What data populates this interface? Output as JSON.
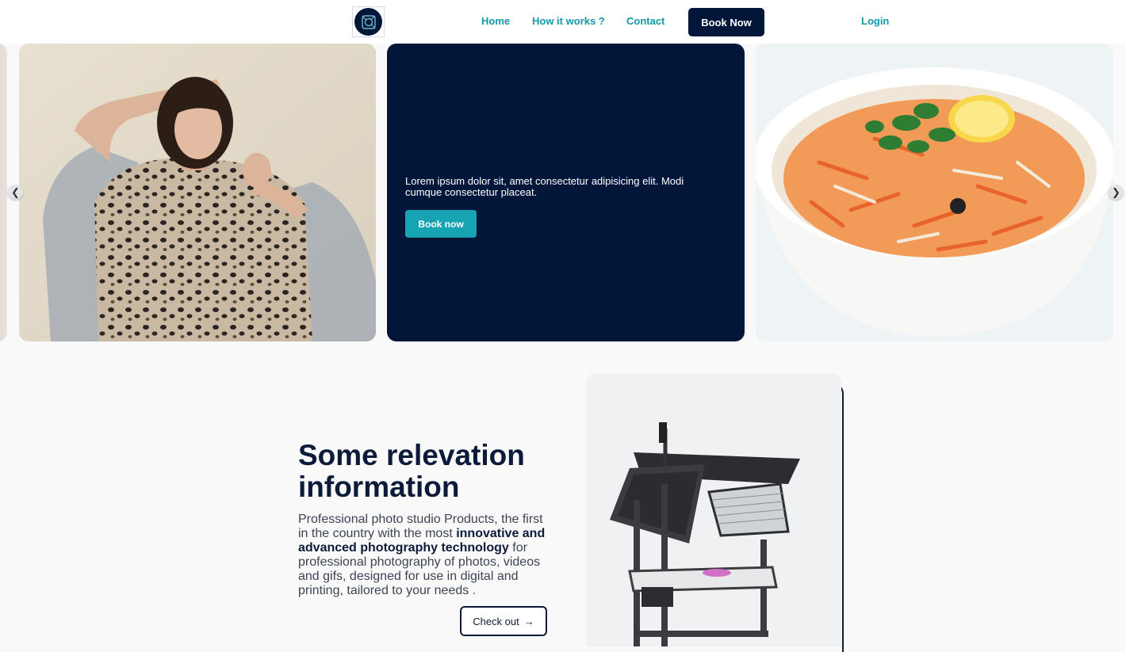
{
  "nav": {
    "links": [
      "Home",
      "How it works ?",
      "Contact"
    ],
    "book_label": "Book Now",
    "login_label": "Login"
  },
  "carousel": {
    "text": "Lorem ipsum dolor sit, amet consectetur adipisicing elit. Modi cumque consectetur placeat.",
    "button_label": "Book now",
    "prev_icon": "chevron-left-icon",
    "next_icon": "chevron-right-icon"
  },
  "info": {
    "title": "Some relevation information",
    "desc_pre": "Professional photo studio Products, the first in the country with the most ",
    "desc_bold": "innovative and advanced photography technology",
    "desc_post": " for professional photography of photos, videos and gifs, designed for use in digital and printing, tailored to your needs .",
    "check_label": "Check out",
    "check_icon": "arrow-right-icon"
  },
  "colors": {
    "navy": "#02163a",
    "teal": "#1398a8",
    "teal_button": "#17a3b2"
  }
}
